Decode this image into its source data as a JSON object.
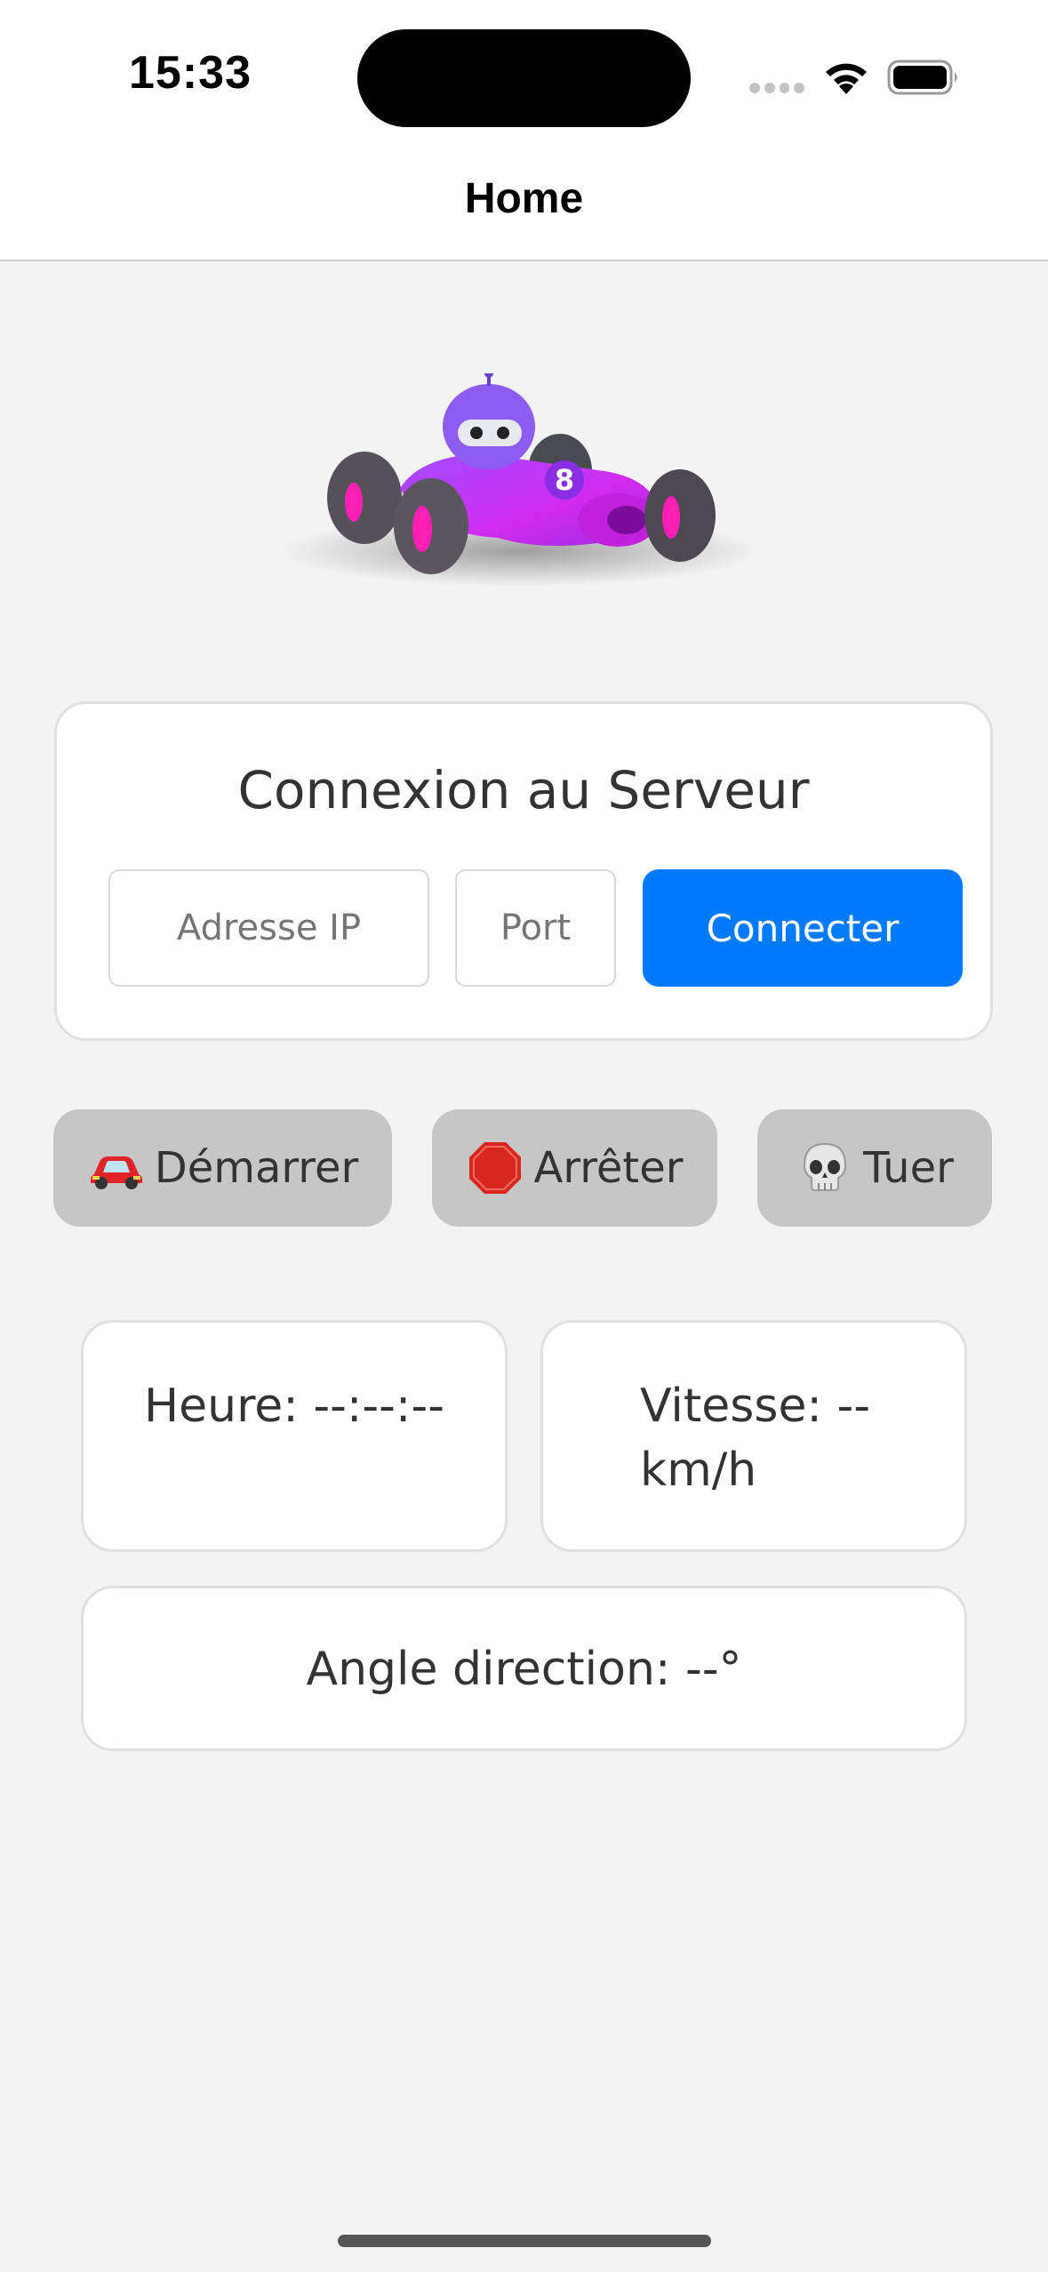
{
  "status_bar": {
    "time": "15:33"
  },
  "nav": {
    "title": "Home"
  },
  "car": {
    "number": "8"
  },
  "connection": {
    "title": "Connexion au Serveur",
    "ip_placeholder": "Adresse IP",
    "port_placeholder": "Port",
    "connect_label": "Connecter",
    "connect_color": "#007aff"
  },
  "actions": {
    "start_label": "Démarrer",
    "start_icon": "car-icon",
    "stop_label": "Arrêter",
    "stop_icon": "stop-sign-icon",
    "kill_label": "Tuer",
    "kill_icon": "skull-icon"
  },
  "telemetry": {
    "time_text": "Heure: --:--:--",
    "speed_line1": "Vitesse: --",
    "speed_line2": "km/h",
    "angle_text": "Angle direction: --°"
  }
}
